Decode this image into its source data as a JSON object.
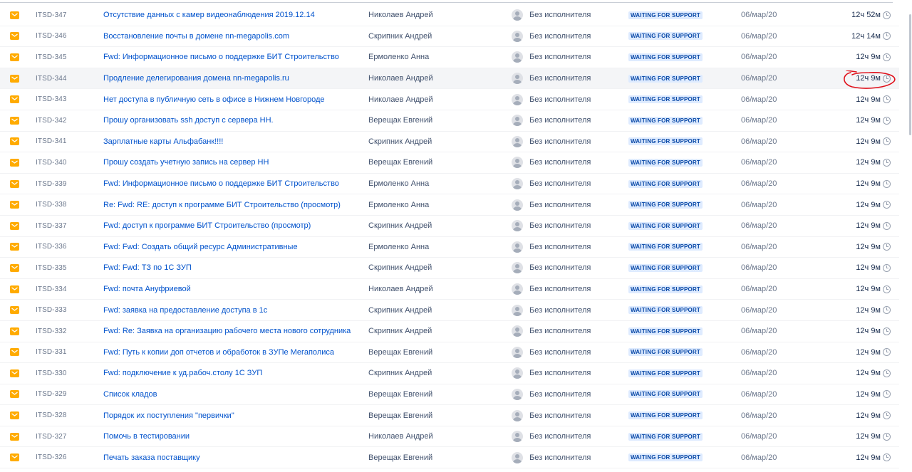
{
  "status_label": "WAITING FOR SUPPORT",
  "assignee_label": "Без исполнителя",
  "date_label": "06/мар/20",
  "colors": {
    "link": "#0052cc",
    "lozenge_bg": "#deebff",
    "lozenge_text": "#0747a6",
    "type_icon": "#ffab00",
    "annotation": "#e0101a"
  },
  "icons": {
    "type": "mail-icon",
    "assignee": "avatar-icon",
    "sla": "clock-icon"
  },
  "rows": [
    {
      "key": "ITSD-347",
      "summary": "Отсутствие данных с камер видеонаблюдения 2019.12.14",
      "reporter": "Николаев Андрей",
      "sla": "12ч 52м"
    },
    {
      "key": "ITSD-346",
      "summary": "Восстановление почты в домене nn-megapolis.com",
      "reporter": "Скрипник Андрей",
      "sla": "12ч 14м"
    },
    {
      "key": "ITSD-345",
      "summary": "Fwd: Информационное письмо о поддержке БИТ Строительство",
      "reporter": "Ермоленко Анна",
      "sla": "12ч 9м"
    },
    {
      "key": "ITSD-344",
      "summary": "Продление делегирования домена nn-megapolis.ru",
      "reporter": "Николаев Андрей",
      "sla": "12ч 9м"
    },
    {
      "key": "ITSD-343",
      "summary": "Нет доступа в публичную сеть в офисе в Нижнем Новгороде",
      "reporter": "Николаев Андрей",
      "sla": "12ч 9м"
    },
    {
      "key": "ITSD-342",
      "summary": "Прошу организовать ssh доступ с сервера НН.",
      "reporter": "Верещак Евгений",
      "sla": "12ч 9м"
    },
    {
      "key": "ITSD-341",
      "summary": "Зарплатные карты Альфабанк!!!!",
      "reporter": "Скрипник Андрей",
      "sla": "12ч 9м"
    },
    {
      "key": "ITSD-340",
      "summary": "Прошу создать учетную запись на сервер НН",
      "reporter": "Верещак Евгений",
      "sla": "12ч 9м"
    },
    {
      "key": "ITSD-339",
      "summary": "Fwd: Информационное письмо о поддержке БИТ Строительство",
      "reporter": "Ермоленко Анна",
      "sla": "12ч 9м"
    },
    {
      "key": "ITSD-338",
      "summary": "Re: Fwd: RE: доступ к программе БИТ Строительство (просмотр)",
      "reporter": "Ермоленко Анна",
      "sla": "12ч 9м"
    },
    {
      "key": "ITSD-337",
      "summary": "Fwd: доступ к программе БИТ Строительство (просмотр)",
      "reporter": "Скрипник Андрей",
      "sla": "12ч 9м"
    },
    {
      "key": "ITSD-336",
      "summary": "Fwd: Fwd: Создать общий ресурс Административные",
      "reporter": "Ермоленко Анна",
      "sla": "12ч 9м"
    },
    {
      "key": "ITSD-335",
      "summary": "Fwd: Fwd: ТЗ по 1С ЗУП",
      "reporter": "Скрипник Андрей",
      "sla": "12ч 9м"
    },
    {
      "key": "ITSD-334",
      "summary": "Fwd: почта Ануфриевой",
      "reporter": "Николаев Андрей",
      "sla": "12ч 9м"
    },
    {
      "key": "ITSD-333",
      "summary": "Fwd: заявка на предоставление доступа в 1с",
      "reporter": "Скрипник Андрей",
      "sla": "12ч 9м"
    },
    {
      "key": "ITSD-332",
      "summary": "Fwd: Re: Заявка на организацию рабочего места нового сотрудника",
      "reporter": "Скрипник Андрей",
      "sla": "12ч 9м"
    },
    {
      "key": "ITSD-331",
      "summary": "Fwd: Путь к копии доп отчетов и обработок в ЗУПе Мегаполиса",
      "reporter": "Верещак Евгений",
      "sla": "12ч 9м"
    },
    {
      "key": "ITSD-330",
      "summary": "Fwd: подключение к уд.рабоч.столу 1С ЗУП",
      "reporter": "Скрипник Андрей",
      "sla": "12ч 9м"
    },
    {
      "key": "ITSD-329",
      "summary": "Список кладов",
      "reporter": "Верещак Евгений",
      "sla": "12ч 9м"
    },
    {
      "key": "ITSD-328",
      "summary": "Порядок их поступления \"первички\"",
      "reporter": "Верещак Евгений",
      "sla": "12ч 9м"
    },
    {
      "key": "ITSD-327",
      "summary": "Помочь в тестировании",
      "reporter": "Николаев Андрей",
      "sla": "12ч 9м"
    },
    {
      "key": "ITSD-326",
      "summary": "Печать заказа поставщику",
      "reporter": "Верещак Евгений",
      "sla": "12ч 9м"
    }
  ]
}
